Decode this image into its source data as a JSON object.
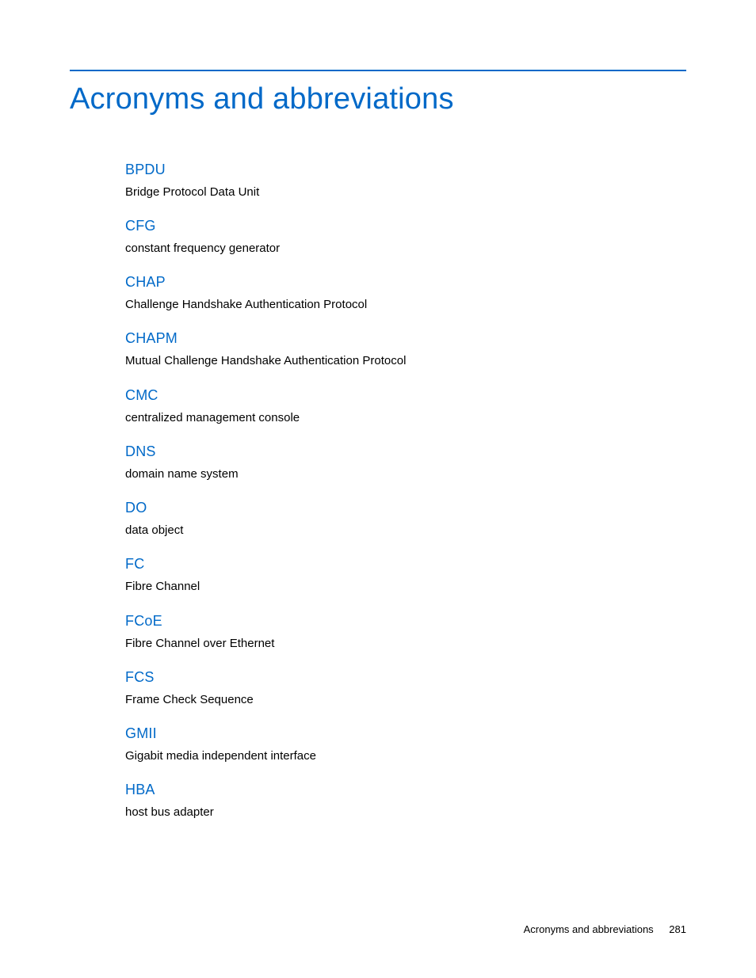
{
  "title": "Acronyms and abbreviations",
  "entries": [
    {
      "term": "BPDU",
      "def": "Bridge Protocol Data Unit"
    },
    {
      "term": "CFG",
      "def": "constant frequency generator"
    },
    {
      "term": "CHAP",
      "def": "Challenge Handshake Authentication Protocol"
    },
    {
      "term": "CHAPM",
      "def": "Mutual Challenge Handshake Authentication Protocol"
    },
    {
      "term": "CMC",
      "def": "centralized management console"
    },
    {
      "term": "DNS",
      "def": "domain name system"
    },
    {
      "term": "DO",
      "def": "data object"
    },
    {
      "term": "FC",
      "def": "Fibre Channel"
    },
    {
      "term": "FCoE",
      "def": "Fibre Channel over Ethernet"
    },
    {
      "term": "FCS",
      "def": "Frame Check Sequence"
    },
    {
      "term": "GMII",
      "def": "Gigabit media independent interface"
    },
    {
      "term": "HBA",
      "def": "host bus adapter"
    }
  ],
  "footer": {
    "section": "Acronyms and abbreviations",
    "page": "281"
  }
}
